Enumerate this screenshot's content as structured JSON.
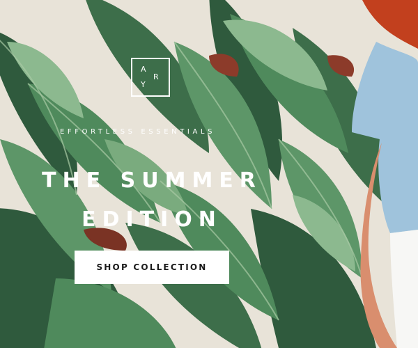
{
  "logo": {
    "letters": [
      "A",
      "Y",
      "R"
    ]
  },
  "tagline": "EFFORTLESS ESSENTIALS",
  "headline": {
    "line1": "THE SUMMER",
    "line2": "EDITION"
  },
  "cta": {
    "label": "SHOP COLLECTION"
  },
  "colors": {
    "leaf_dark": "#2f5a3d",
    "leaf_mid": "#4f8a5c",
    "leaf_light": "#8cb98f",
    "wall": "#e8e3d8",
    "denim": "#9fc3dc",
    "hair": "#c2401e"
  }
}
